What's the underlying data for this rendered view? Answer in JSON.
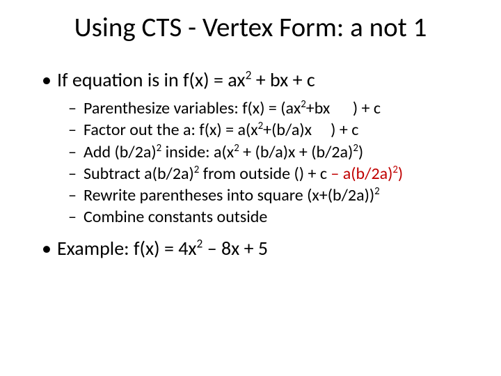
{
  "title": "Using CTS - Vertex Form: a not 1",
  "bullets": {
    "lvl1_1_pre": "If equation is in f(x) = ax",
    "lvl1_1_post": " + bx + c",
    "sub": {
      "s1_pre": "Parenthesize variables:  f(x) = (ax",
      "s1_mid": "+bx      ) + c",
      "s2_pre": "Factor out the a:  f(x) = a(x",
      "s2_mid": "+(b/a)x     ) + c",
      "s3_pre": "Add (b/2a)",
      "s3_mid": " inside: a(x",
      "s3_mid2": " + (b/a)x + (b/2a)",
      "s3_end": ")",
      "s4_pre": "Subtract a(b/2a)",
      "s4_mid": " from outside () + c ",
      "s4_red_pre": "– a(b/2a)",
      "s4_red_post": ")",
      "s5_pre": "Rewrite parentheses into square (x+(b/2a))",
      "s6": "Combine constants outside"
    },
    "lvl1_2_pre": "Example:  f(x) = 4x",
    "lvl1_2_post": " – 8x + 5"
  },
  "sup2": "2"
}
